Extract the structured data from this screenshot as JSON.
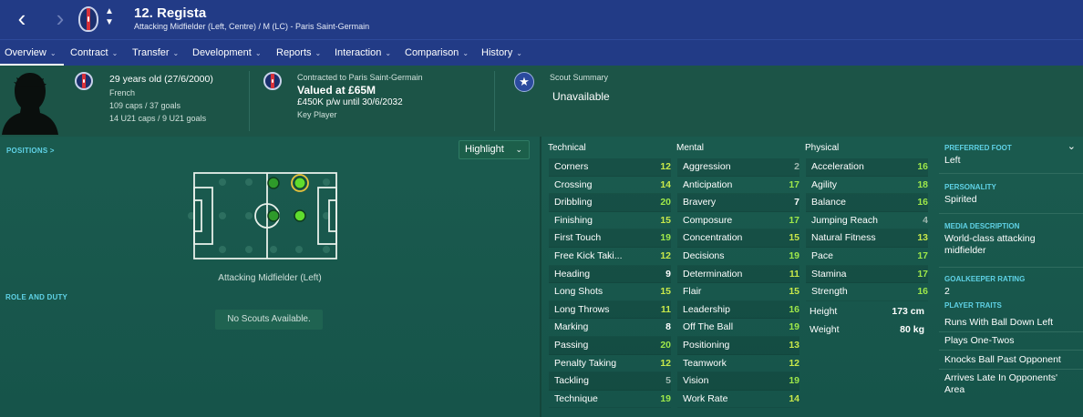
{
  "header": {
    "back_icon": "‹",
    "forward_icon": "›",
    "name": "12. Regista",
    "subtitle": "Attacking Midfielder (Left, Centre) / M (LC) - Paris Saint-Germain"
  },
  "tabs": [
    {
      "label": "Overview",
      "active": true
    },
    {
      "label": "Contract",
      "active": false
    },
    {
      "label": "Transfer",
      "active": false
    },
    {
      "label": "Development",
      "active": false
    },
    {
      "label": "Reports",
      "active": false
    },
    {
      "label": "Interaction",
      "active": false
    },
    {
      "label": "Comparison",
      "active": false
    },
    {
      "label": "History",
      "active": false
    }
  ],
  "info": {
    "age": "29 years old (27/6/2000)",
    "nationality": "French",
    "caps": "109 caps / 37 goals",
    "u21_caps": "14 U21 caps / 9 U21 goals",
    "contract_club": "Contracted to Paris Saint-Germain",
    "value": "Valued at £65M",
    "wage": "£450K p/w until 30/6/2032",
    "status": "Key Player",
    "scout_title": "Scout Summary",
    "scout_value": "Unavailable"
  },
  "left": {
    "positions_label": "POSITIONS >",
    "highlight_label": "Highlight",
    "position_caption": "Attacking Midfielder (Left)",
    "role_label": "ROLE AND DUTY",
    "no_scouts": "No Scouts Available."
  },
  "attributes": {
    "technical_title": "Technical",
    "mental_title": "Mental",
    "physical_title": "Physical",
    "technical": [
      {
        "label": "Corners",
        "value": "12"
      },
      {
        "label": "Crossing",
        "value": "14"
      },
      {
        "label": "Dribbling",
        "value": "20"
      },
      {
        "label": "Finishing",
        "value": "15"
      },
      {
        "label": "First Touch",
        "value": "19"
      },
      {
        "label": "Free Kick Taki...",
        "value": "12"
      },
      {
        "label": "Heading",
        "value": "9"
      },
      {
        "label": "Long Shots",
        "value": "15"
      },
      {
        "label": "Long Throws",
        "value": "11"
      },
      {
        "label": "Marking",
        "value": "8"
      },
      {
        "label": "Passing",
        "value": "20"
      },
      {
        "label": "Penalty Taking",
        "value": "12"
      },
      {
        "label": "Tackling",
        "value": "5"
      },
      {
        "label": "Technique",
        "value": "19"
      }
    ],
    "mental": [
      {
        "label": "Aggression",
        "value": "2"
      },
      {
        "label": "Anticipation",
        "value": "17"
      },
      {
        "label": "Bravery",
        "value": "7"
      },
      {
        "label": "Composure",
        "value": "17"
      },
      {
        "label": "Concentration",
        "value": "15"
      },
      {
        "label": "Decisions",
        "value": "19"
      },
      {
        "label": "Determination",
        "value": "11"
      },
      {
        "label": "Flair",
        "value": "15"
      },
      {
        "label": "Leadership",
        "value": "16"
      },
      {
        "label": "Off The Ball",
        "value": "19"
      },
      {
        "label": "Positioning",
        "value": "13"
      },
      {
        "label": "Teamwork",
        "value": "12"
      },
      {
        "label": "Vision",
        "value": "19"
      },
      {
        "label": "Work Rate",
        "value": "14"
      }
    ],
    "physical": [
      {
        "label": "Acceleration",
        "value": "16"
      },
      {
        "label": "Agility",
        "value": "18"
      },
      {
        "label": "Balance",
        "value": "16"
      },
      {
        "label": "Jumping Reach",
        "value": "4"
      },
      {
        "label": "Natural Fitness",
        "value": "13"
      },
      {
        "label": "Pace",
        "value": "17"
      },
      {
        "label": "Stamina",
        "value": "17"
      },
      {
        "label": "Strength",
        "value": "16"
      }
    ],
    "height_label": "Height",
    "height_value": "173 cm",
    "weight_label": "Weight",
    "weight_value": "80 kg",
    "value_colors": {
      "elite": "#9ee84a",
      "good": "#c8e84a",
      "mid": "#ffffff",
      "low": "#9fb8b0"
    }
  },
  "profile": {
    "preferred_foot_label": "PREFERRED FOOT",
    "preferred_foot": "Left",
    "personality_label": "PERSONALITY",
    "personality": "Spirited",
    "media_label": "MEDIA DESCRIPTION",
    "media": "World-class attacking midfielder",
    "gk_label": "GOALKEEPER RATING",
    "gk_rating": "2",
    "traits_label": "PLAYER TRAITS",
    "traits": [
      "Runs With Ball Down Left",
      "Plays One-Twos",
      "Knocks Ball Past Opponent",
      "Arrives Late In Opponents' Area"
    ]
  }
}
